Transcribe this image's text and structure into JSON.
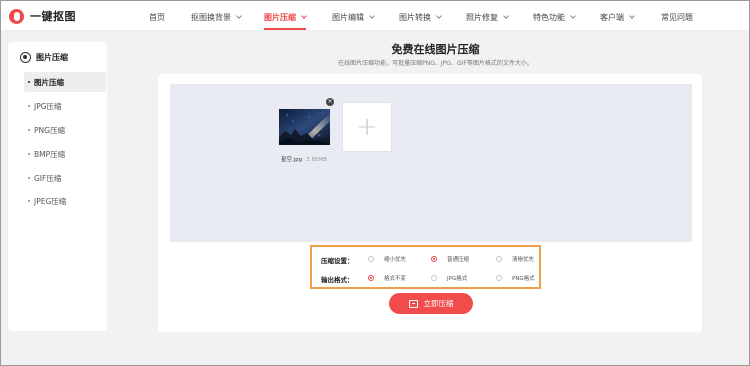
{
  "app": {
    "logo_text": "一键抠图"
  },
  "nav": {
    "items": [
      {
        "label": "首页",
        "dropdown": false
      },
      {
        "label": "抠图换背景",
        "dropdown": true
      },
      {
        "label": "图片压缩",
        "dropdown": true,
        "active": true
      },
      {
        "label": "图片编辑",
        "dropdown": true
      },
      {
        "label": "图片转换",
        "dropdown": true
      },
      {
        "label": "照片修复",
        "dropdown": true
      },
      {
        "label": "特色功能",
        "dropdown": true
      },
      {
        "label": "客户端",
        "dropdown": true
      },
      {
        "label": "常见问题",
        "dropdown": false
      }
    ]
  },
  "sidebar": {
    "title": "图片压缩",
    "items": [
      {
        "label": "图片压缩",
        "active": true
      },
      {
        "label": "JPG压缩"
      },
      {
        "label": "PNG压缩"
      },
      {
        "label": "BMP压缩"
      },
      {
        "label": "GIF压缩"
      },
      {
        "label": "JPEG压缩"
      }
    ]
  },
  "main": {
    "title": "免费在线图片压缩",
    "subtitle": "在线图片压缩功能，可批量压缩PNG、JPG、GIF等图片格式的文件大小。"
  },
  "upload": {
    "file_name": "星空.jpg",
    "file_size": "3.85MB",
    "add_symbol": "+",
    "close_symbol": "×"
  },
  "options": {
    "compress_label": "压缩设置：",
    "compress_options": [
      "缩小优先",
      "普通压缩",
      "清晰优先"
    ],
    "compress_selected": "普通压缩",
    "format_label": "输出格式：",
    "format_options": [
      "格式不变",
      "JPG格式",
      "PNG格式"
    ],
    "format_selected": "格式不变"
  },
  "action": {
    "compress_button": "立即压缩"
  },
  "colors": {
    "accent": "#f04848",
    "highlight_border": "#f0a04c",
    "dropzone_bg": "#e9ebf3"
  }
}
